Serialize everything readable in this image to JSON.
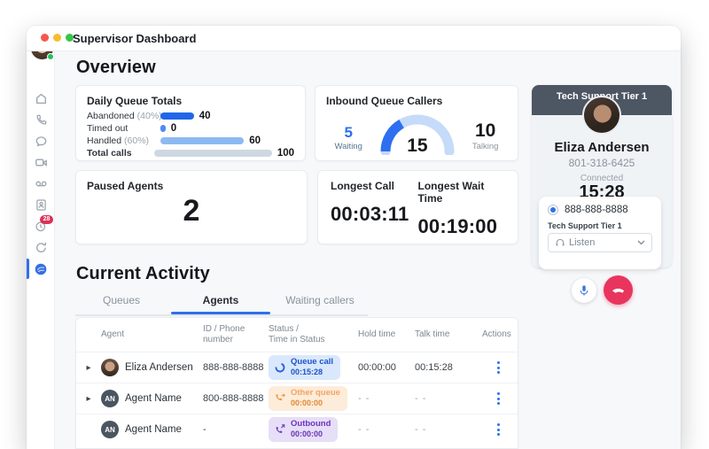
{
  "colors": {
    "accent_blue": "#2d6ff0",
    "bar_abandoned": "#2166e8",
    "bar_timedout": "#4f8bf0",
    "bar_handled": "#8db9f2",
    "bar_total": "#ced8e2",
    "gauge_track": "#c5dbf9",
    "gauge_value": "#2d6ff0",
    "header_dark": "#4d5663",
    "end_call": "#e8355e",
    "sidebar_badge": "#dc3255",
    "badge_queue_bg": "#d9e8fc",
    "badge_queue_text": "#1c54c8",
    "badge_other_bg": "#fdecd9",
    "badge_outbound_bg": "#e7def7",
    "badge_outbound_text": "#6b33b8"
  },
  "window": {
    "title": "Supervisor Dashboard"
  },
  "sidebar": {
    "notification_count": "28",
    "icons": [
      "home",
      "phone",
      "chat",
      "video",
      "voicemail",
      "contacts",
      "history",
      "refresh",
      "ai-assistant"
    ]
  },
  "overview": {
    "heading": "Overview",
    "daily_queue_totals": {
      "title": "Daily Queue Totals",
      "rows": [
        {
          "label": "Abandoned",
          "suffix": "(40%)",
          "value": "40",
          "pct": 26
        },
        {
          "label": "Timed out",
          "suffix": "",
          "value": "0",
          "pct": 4
        },
        {
          "label": "Handled",
          "suffix": "(60%)",
          "value": "60",
          "pct": 65
        },
        {
          "label": "Total calls",
          "suffix": "",
          "value": "100",
          "pct": 100
        }
      ]
    },
    "inbound_queue_callers": {
      "title": "Inbound Queue Callers",
      "waiting": {
        "value": 5,
        "label": "Waiting"
      },
      "center_value": 15,
      "talking": {
        "value": 10,
        "label": "Talking"
      }
    },
    "paused_agents": {
      "title": "Paused Agents",
      "value": "2"
    },
    "longest": {
      "call_title": "Longest Call",
      "call_value": "00:03:11",
      "wait_title": "Longest Wait Time",
      "wait_value": "00:19:00"
    }
  },
  "chart_data": [
    {
      "type": "bar",
      "orientation": "horizontal",
      "title": "Daily Queue Totals",
      "categories": [
        "Abandoned (40%)",
        "Timed out",
        "Handled (60%)",
        "Total calls"
      ],
      "values": [
        40,
        0,
        60,
        100
      ],
      "xlim": [
        0,
        100
      ]
    },
    {
      "type": "gauge",
      "title": "Inbound Queue Callers",
      "total": 15,
      "segments": [
        {
          "label": "Waiting",
          "value": 5
        },
        {
          "label": "Talking",
          "value": 10
        }
      ]
    }
  ],
  "current_activity": {
    "heading": "Current Activity",
    "tabs": [
      {
        "label": "Queues"
      },
      {
        "label": "Agents",
        "active": true
      },
      {
        "label": "Waiting callers"
      }
    ],
    "table": {
      "headers": [
        {
          "label": "Agent"
        },
        {
          "label": "ID / Phone number"
        },
        {
          "label": "Status /",
          "label2": "Time in Status"
        },
        {
          "label": "Hold time"
        },
        {
          "label": "Talk time"
        },
        {
          "label": "Actions"
        }
      ],
      "rows": [
        {
          "name": "Eliza Andersen",
          "id": "888-888-8888",
          "status_label": "Queue call",
          "status_time": "00:15:28",
          "hold": "00:00:00",
          "talk": "00:15:28",
          "avatar_initials": "",
          "expandable": true
        },
        {
          "name": "Agent Name",
          "id": "800-888-8888",
          "status_label": "Other queue",
          "status_time": "00:00:00",
          "hold": "- -",
          "talk": "- -",
          "avatar_initials": "AN",
          "expandable": true
        },
        {
          "name": "Agent Name",
          "id": "-",
          "status_label": "Outbound",
          "status_time": "00:00:00",
          "hold": "- -",
          "talk": "- -",
          "avatar_initials": "AN",
          "expandable": false
        }
      ]
    }
  },
  "call_panel": {
    "queue_title": "Tech Support Tier 1",
    "caller_name": "Eliza Andersen",
    "caller_number": "801-318-6425",
    "status_label": "Connected",
    "timer": "15:28",
    "line_number": "888-888-8888",
    "line_queue": "Tech Support Tier 1",
    "listen_label": "Listen",
    "expand_caret": "▸"
  }
}
